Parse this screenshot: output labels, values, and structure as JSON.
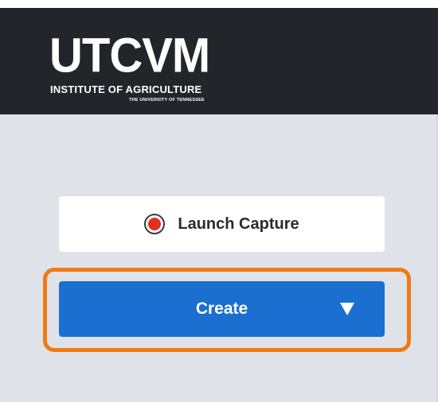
{
  "header": {
    "logo": {
      "main": "UTCVM",
      "line1": "INSTITUTE OF AGRICULTURE",
      "line2": "THE UNIVERSITY OF TENNESSEE"
    }
  },
  "actions": {
    "launch_capture": {
      "label": "Launch Capture",
      "icon": "record-icon"
    },
    "create": {
      "label": "Create",
      "icon": "caret-down-icon"
    }
  },
  "colors": {
    "header_bg": "#22262a",
    "panel_bg": "#dfe3e9",
    "create_bg": "#1b6fd0",
    "record_red": "#e0301e",
    "highlight": "#f07a12"
  }
}
